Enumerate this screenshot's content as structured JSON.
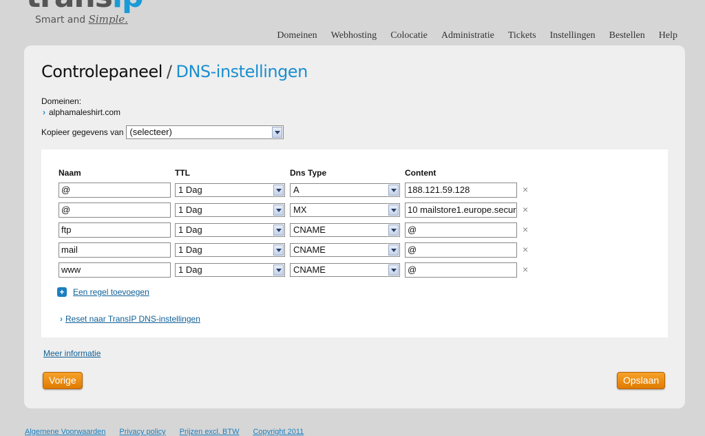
{
  "brand": {
    "logo_text": "transip",
    "tagline_prefix": "Smart and",
    "tagline_script": "Simple."
  },
  "nav": [
    "Domeinen",
    "Webhosting",
    "Colocatie",
    "Administratie",
    "Tickets",
    "Instellingen",
    "Bestellen",
    "Help"
  ],
  "page": {
    "title_main": "Controlepaneel",
    "title_sep": "/",
    "title_sub": "DNS-instellingen"
  },
  "domains": {
    "label": "Domeinen:",
    "items": [
      "alphamaleshirt.com"
    ]
  },
  "copy": {
    "label": "Kopieer gegevens van",
    "selected": "(selecteer)"
  },
  "table": {
    "headers": {
      "name": "Naam",
      "ttl": "TTL",
      "type": "Dns Type",
      "content": "Content"
    },
    "rows": [
      {
        "name": "@",
        "ttl": "1 Dag",
        "type": "A",
        "content": "188.121.59.128"
      },
      {
        "name": "@",
        "ttl": "1 Dag",
        "type": "MX",
        "content": "10 mailstore1.europe.secur"
      },
      {
        "name": "ftp",
        "ttl": "1 Dag",
        "type": "CNAME",
        "content": "@"
      },
      {
        "name": "mail",
        "ttl": "1 Dag",
        "type": "CNAME",
        "content": "@"
      },
      {
        "name": "www",
        "ttl": "1 Dag",
        "type": "CNAME",
        "content": "@"
      }
    ],
    "delete_glyph": "×"
  },
  "actions": {
    "add_rule": "Een regel toevoegen",
    "reset": "Reset naar TransIP DNS-instellingen",
    "more_info": "Meer informatie",
    "previous": "Vorige",
    "save": "Opslaan"
  },
  "footer": [
    "Algemene Voorwaarden",
    "Privacy policy",
    "Prijzen excl. BTW",
    "Copyright 2011"
  ],
  "colors": {
    "accent_blue": "#1a8fd0",
    "button_orange": "#f08c0e",
    "panel_bg": "#efefef"
  }
}
